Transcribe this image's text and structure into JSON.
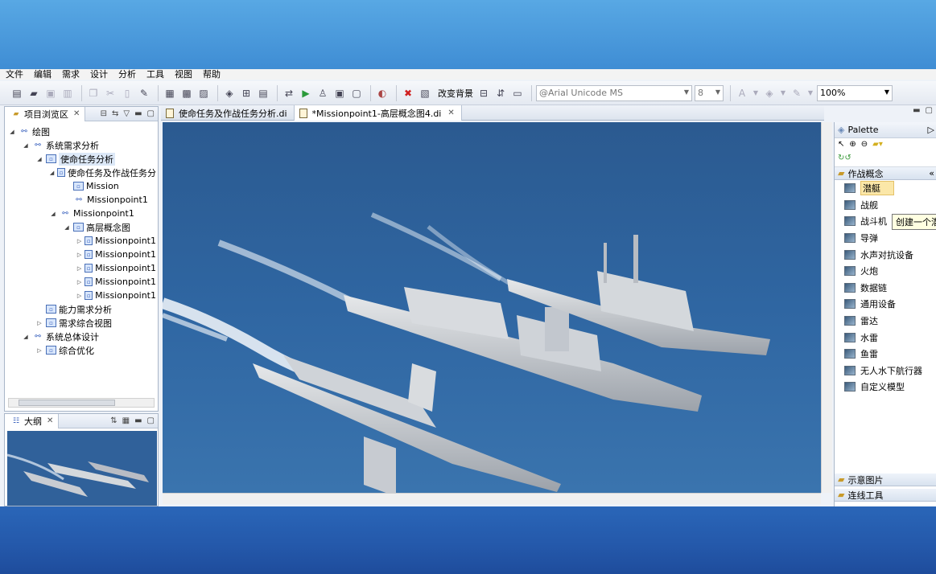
{
  "menu": [
    "文件",
    "编辑",
    "需求",
    "设计",
    "分析",
    "工具",
    "视图",
    "帮助"
  ],
  "toolbar": {
    "change_background": "改变背景",
    "font": "@Arial Unicode MS",
    "font_size": "8",
    "zoom": "100%"
  },
  "project_explorer": {
    "title": "项目浏览区",
    "tree": [
      {
        "depth": 0,
        "label": "绘图",
        "icon": "tree"
      },
      {
        "depth": 1,
        "label": "系统需求分析",
        "icon": "tree"
      },
      {
        "depth": 2,
        "label": "使命任务分析",
        "icon": "box",
        "selected": true
      },
      {
        "depth": 3,
        "label": "使命任务及作战任务分",
        "icon": "box"
      },
      {
        "depth": 4,
        "label": "Mission",
        "icon": "box"
      },
      {
        "depth": 4,
        "label": "Missionpoint1",
        "icon": "tree"
      },
      {
        "depth": 3,
        "label": "Missionpoint1",
        "icon": "tree"
      },
      {
        "depth": 4,
        "label": "高层概念图",
        "icon": "box"
      },
      {
        "depth": 5,
        "label": "Missionpoint1",
        "icon": "box"
      },
      {
        "depth": 5,
        "label": "Missionpoint1",
        "icon": "box"
      },
      {
        "depth": 5,
        "label": "Missionpoint1",
        "icon": "box"
      },
      {
        "depth": 5,
        "label": "Missionpoint1",
        "icon": "box"
      },
      {
        "depth": 5,
        "label": "Missionpoint1",
        "icon": "box"
      },
      {
        "depth": 2,
        "label": "能力需求分析",
        "icon": "box"
      },
      {
        "depth": 2,
        "label": "需求综合视图",
        "icon": "box"
      },
      {
        "depth": 1,
        "label": "系统总体设计",
        "icon": "tree"
      },
      {
        "depth": 2,
        "label": "综合优化",
        "icon": "box"
      }
    ]
  },
  "outline": {
    "title": "大纲"
  },
  "editor": {
    "tabs": [
      {
        "label": "使命任务及作战任务分析.di",
        "active": false
      },
      {
        "label": "*Missionpoint1-高层概念图4.di",
        "active": true
      }
    ]
  },
  "palette": {
    "title": "Palette",
    "drawer": "作战概念",
    "items": [
      "潜艇",
      "战舰",
      "战斗机",
      "导弹",
      "水声对抗设备",
      "火炮",
      "数据链",
      "通用设备",
      "雷达",
      "水雷",
      "鱼雷",
      "无人水下航行器",
      "自定义模型"
    ],
    "bottom_drawers": [
      "示意图片",
      "连线工具"
    ],
    "tooltip": "创建一个潜"
  },
  "colors": {
    "sea": "#2c5f98",
    "accent": "#3e86cc"
  }
}
